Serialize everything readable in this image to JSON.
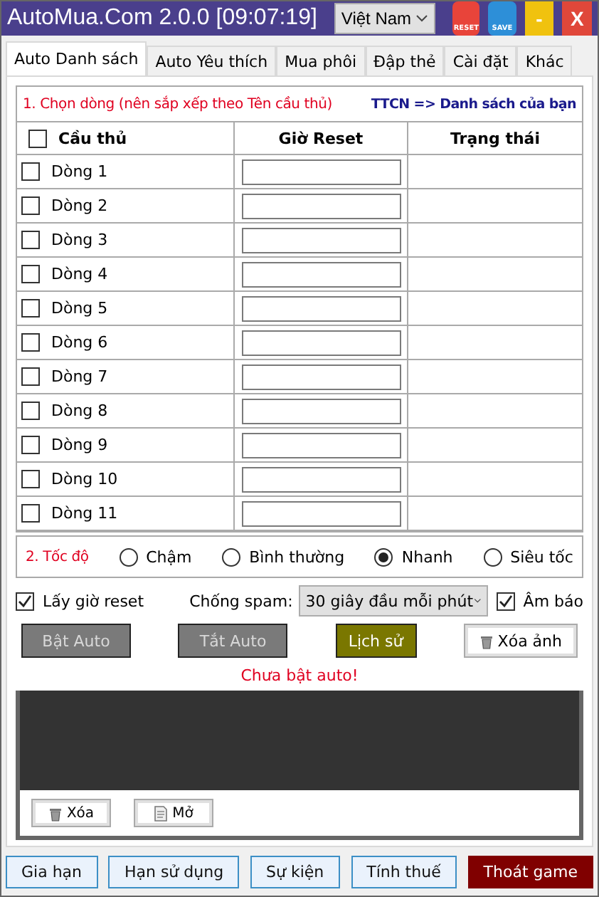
{
  "window": {
    "title": "AutoMua.Com 2.0.0 [09:07:19]",
    "language": "Việt Nam",
    "reset_label": "RESET",
    "save_label": "SAVE",
    "minimize": "-",
    "close": "X"
  },
  "tabs": [
    {
      "label": "Auto Danh sách",
      "selected": true
    },
    {
      "label": "Auto Yêu thích",
      "selected": false
    },
    {
      "label": "Mua phôi",
      "selected": false
    },
    {
      "label": "Đập thẻ",
      "selected": false
    },
    {
      "label": "Cài đặt",
      "selected": false
    },
    {
      "label": "Khác",
      "selected": false
    }
  ],
  "section1": {
    "title": "1. Chọn dòng (nên sắp xếp theo Tên cầu thủ)",
    "link": "TTCN => Danh sách của bạn"
  },
  "table": {
    "columns": [
      "Cầu thủ",
      "Giờ Reset",
      "Trạng thái"
    ],
    "all_checked": false,
    "rows": [
      {
        "name": "Dòng 1",
        "checked": false
      },
      {
        "name": "Dòng 2",
        "checked": false
      },
      {
        "name": "Dòng 3",
        "checked": false
      },
      {
        "name": "Dòng 4",
        "checked": false
      },
      {
        "name": "Dòng 5",
        "checked": false
      },
      {
        "name": "Dòng 6",
        "checked": false
      },
      {
        "name": "Dòng 7",
        "checked": false
      },
      {
        "name": "Dòng 8",
        "checked": false
      },
      {
        "name": "Dòng 9",
        "checked": false
      },
      {
        "name": "Dòng 10",
        "checked": false
      },
      {
        "name": "Dòng 11",
        "checked": false
      }
    ]
  },
  "speed": {
    "title": "2. Tốc độ",
    "options": [
      {
        "label": "Chậm",
        "selected": false
      },
      {
        "label": "Bình thường",
        "selected": false
      },
      {
        "label": "Nhanh",
        "selected": true
      },
      {
        "label": "Siêu tốc",
        "selected": false
      }
    ]
  },
  "options": {
    "get_reset": {
      "label": "Lấy giờ reset",
      "checked": true
    },
    "spam_label": "Chống spam:",
    "spam_value": "30 giây đầu mỗi phút",
    "sound": {
      "label": "Âm báo",
      "checked": true
    }
  },
  "actions": [
    {
      "label": "Bật Auto",
      "kind": "grey"
    },
    {
      "label": "Tắt Auto",
      "kind": "grey"
    },
    {
      "label": "Lịch sử",
      "kind": "olive"
    },
    {
      "label": "Xóa ảnh",
      "kind": "trash"
    }
  ],
  "status": "Chưa bật auto!",
  "log_buttons": [
    {
      "label": "Xóa",
      "kind": "trash"
    },
    {
      "label": "Mở",
      "kind": "doc"
    }
  ],
  "footer": [
    {
      "label": "Gia hạn",
      "kind": "light"
    },
    {
      "label": "Hạn sử dụng",
      "kind": "light"
    },
    {
      "label": "Sự kiện",
      "kind": "light"
    },
    {
      "label": "Tính thuế",
      "kind": "light"
    },
    {
      "label": "Thoát game",
      "kind": "danger"
    }
  ]
}
